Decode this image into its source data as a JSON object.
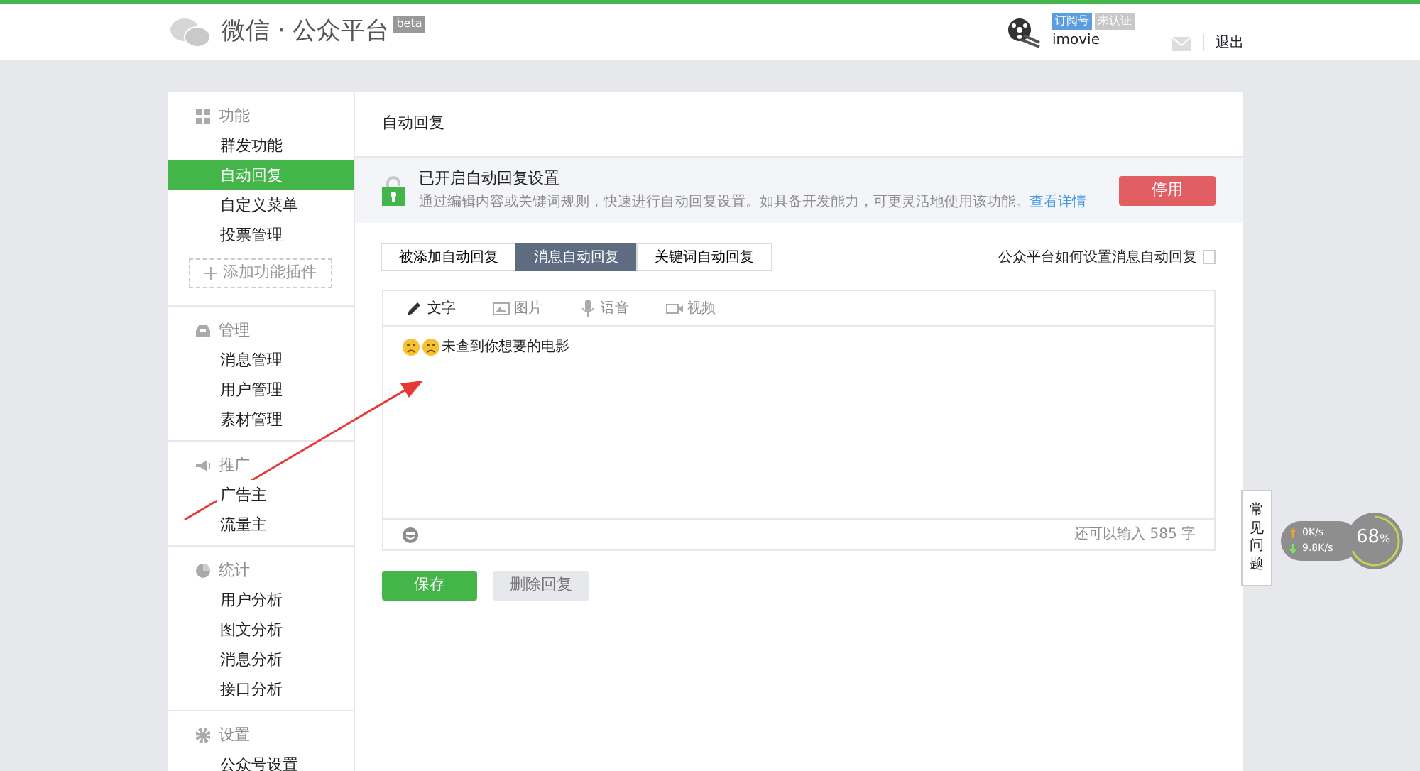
{
  "header": {
    "title": "微信 · 公众平台",
    "beta": "beta",
    "account": {
      "badges": [
        "订阅号",
        "未认证"
      ],
      "name": "imovie"
    },
    "logout": "退出"
  },
  "sidebar": {
    "sections": [
      {
        "title": "功能",
        "items": [
          {
            "label": "群发功能",
            "selected": false
          },
          {
            "label": "自动回复",
            "selected": true
          },
          {
            "label": "自定义菜单",
            "selected": false
          },
          {
            "label": "投票管理",
            "selected": false
          }
        ],
        "add_button": "添加功能插件"
      },
      {
        "title": "管理",
        "items": [
          {
            "label": "消息管理",
            "selected": false
          },
          {
            "label": "用户管理",
            "selected": false
          },
          {
            "label": "素材管理",
            "selected": false
          }
        ]
      },
      {
        "title": "推广",
        "items": [
          {
            "label": "广告主",
            "selected": false
          },
          {
            "label": "流量主",
            "selected": false
          }
        ]
      },
      {
        "title": "统计",
        "items": [
          {
            "label": "用户分析",
            "selected": false
          },
          {
            "label": "图文分析",
            "selected": false
          },
          {
            "label": "消息分析",
            "selected": false
          },
          {
            "label": "接口分析",
            "selected": false
          }
        ]
      },
      {
        "title": "设置",
        "items": [
          {
            "label": "公众号设置",
            "selected": false
          }
        ]
      }
    ]
  },
  "content": {
    "title": "自动回复",
    "notice": {
      "title": "已开启自动回复设置",
      "text": "通过编辑内容或关键词规则，快速进行自动回复设置。如具备开发能力，可更灵活地使用该功能。",
      "link": "查看详情",
      "button": "停用"
    },
    "tabs": [
      {
        "label": "被添加自动回复",
        "selected": false
      },
      {
        "label": "消息自动回复",
        "selected": true
      },
      {
        "label": "关键词自动回复",
        "selected": false
      }
    ],
    "help_link": "公众平台如何设置消息自动回复",
    "editor": {
      "media_tabs": [
        {
          "label": "文字",
          "selected": true
        },
        {
          "label": "图片",
          "selected": false
        },
        {
          "label": "语音",
          "selected": false
        },
        {
          "label": "视频",
          "selected": false
        }
      ],
      "message": "未查到你想要的电影",
      "counter": "还可以输入 585 字"
    },
    "buttons": {
      "save": "保存",
      "delete": {
        "label": "删除回复",
        "disabled": true
      }
    }
  },
  "faq_tab": "常见问题",
  "speed_widget": {
    "upload": "0",
    "upload_unit": "K/s",
    "download": "9.8",
    "download_unit": "K/s",
    "percent": "68",
    "percent_sign": "%",
    "level": 0.68
  }
}
